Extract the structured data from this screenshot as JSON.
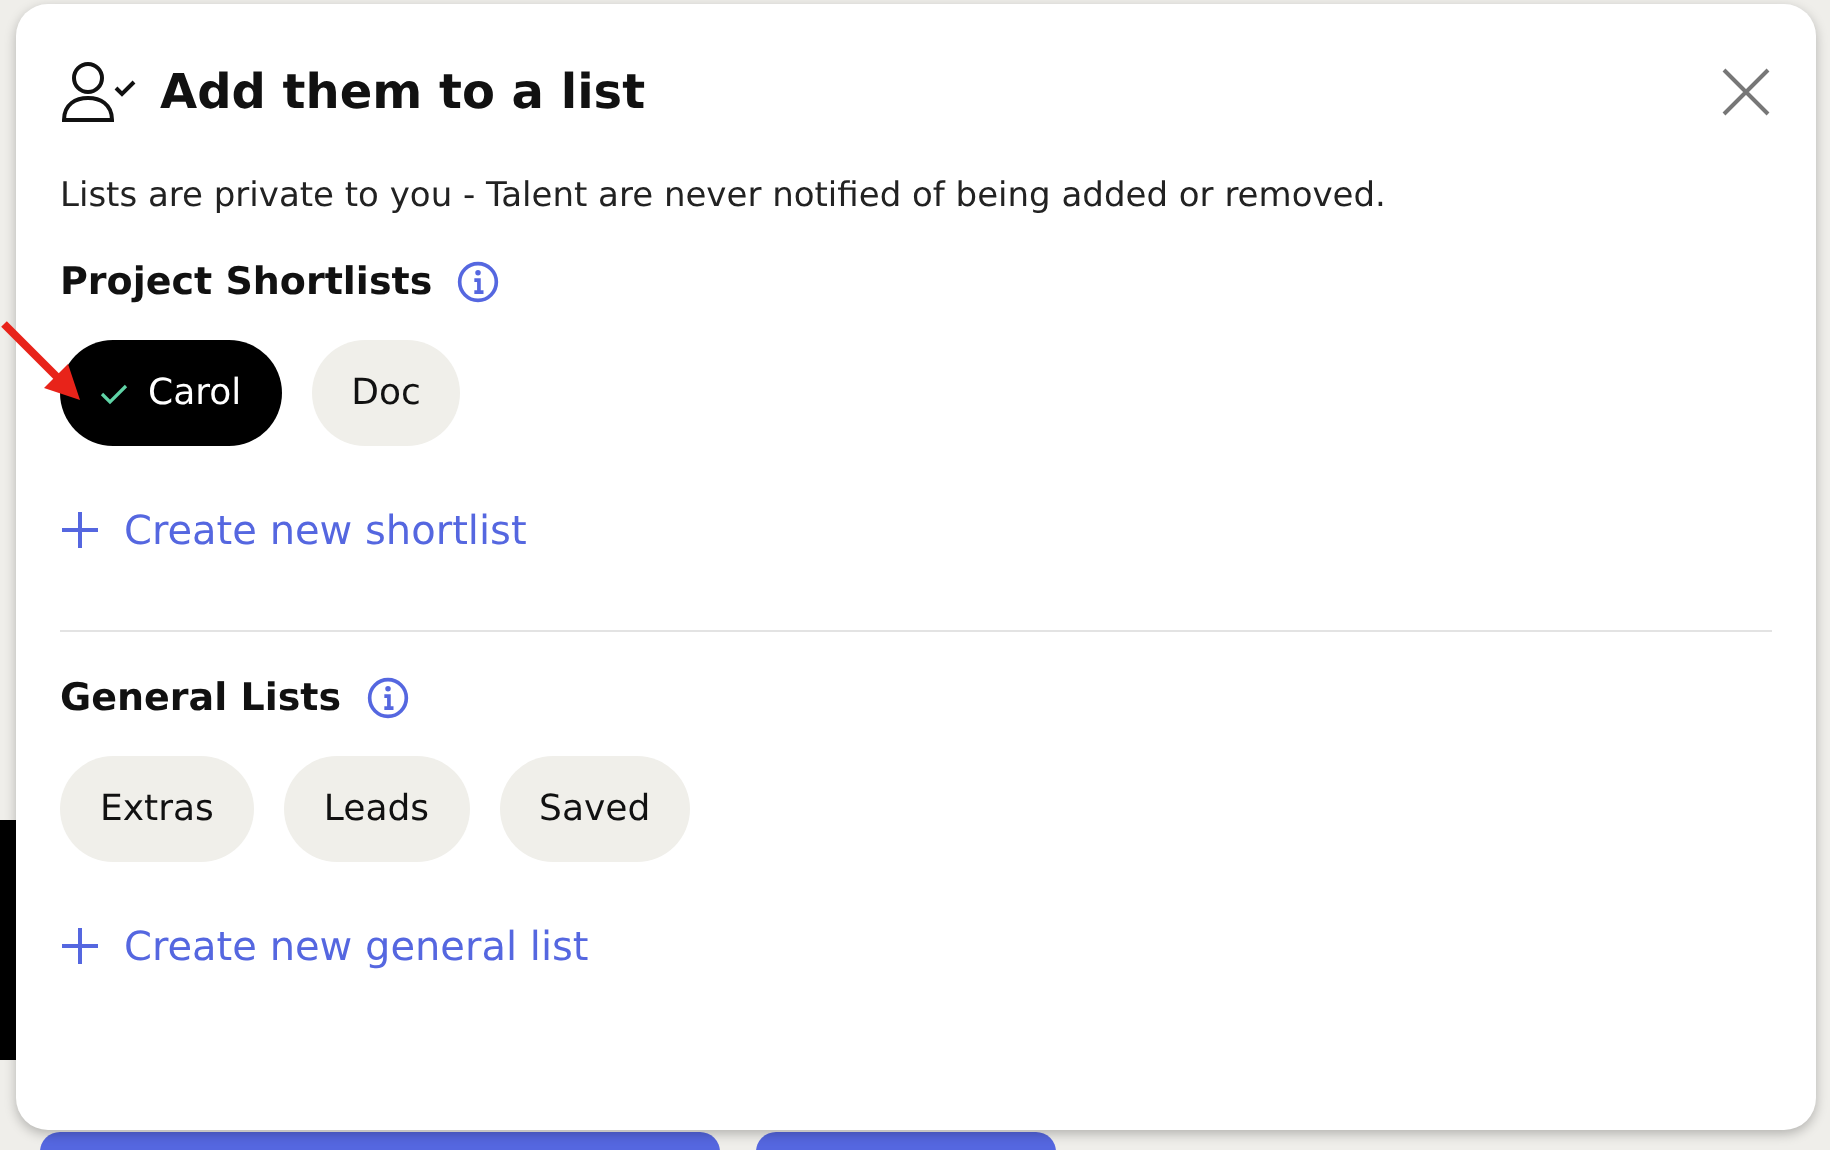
{
  "dialog": {
    "title": "Add them to a list",
    "description": "Lists are private to you - Talent are never notified of being added or removed.",
    "sections": [
      {
        "title": "Project Shortlists",
        "lists": [
          {
            "label": "Carol",
            "selected": true
          },
          {
            "label": "Doc",
            "selected": false
          }
        ],
        "create_label": "Create new shortlist"
      },
      {
        "title": "General Lists",
        "lists": [
          {
            "label": "Extras",
            "selected": false
          },
          {
            "label": "Leads",
            "selected": false
          },
          {
            "label": "Saved",
            "selected": false
          }
        ],
        "create_label": "Create new general list"
      }
    ]
  }
}
